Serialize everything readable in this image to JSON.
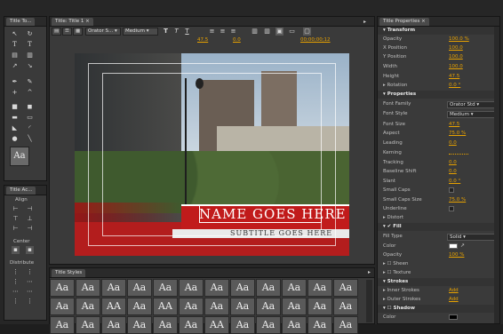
{
  "tabs": {
    "title_tools": "Title To...",
    "title_main": "Title: Title 1",
    "title_properties": "Title Properties",
    "title_actions": "Title Ac...",
    "title_styles": "Title Styles"
  },
  "toolbar": {
    "font_family": "Orator S...",
    "font_style": "Medium",
    "font_size": "47.5",
    "kerning": "0.0",
    "timecode": "00;00;00;12"
  },
  "title_text": {
    "name": "NAME GOES HERE",
    "subtitle": "SUBTITLE GOES HERE"
  },
  "actions": {
    "align": "Align",
    "center": "Center",
    "distribute": "Distribute"
  },
  "preview_glyph": "Aa",
  "properties": {
    "transform": "Transform",
    "opacity_label": "Opacity",
    "opacity": "100.0 %",
    "xpos_label": "X Position",
    "xpos": "100.0",
    "ypos_label": "Y Position",
    "ypos": "100.0",
    "width_label": "Width",
    "width": "100.0",
    "height_label": "Height",
    "height": "47.5",
    "rotation_label": "Rotation",
    "rotation": "0.0 °",
    "props": "Properties",
    "font_family_label": "Font Family",
    "font_family": "Orator Std",
    "font_style_label": "Font Style",
    "font_style": "Medium",
    "font_size_label": "Font Size",
    "font_size": "47.5",
    "aspect_label": "Aspect",
    "aspect": "75.0 %",
    "leading_label": "Leading",
    "leading": "0.0",
    "kerning_label": "Kerning",
    "kerning": "",
    "tracking_label": "Tracking",
    "tracking": "0.0",
    "baseline_label": "Baseline Shift",
    "baseline": "0.0",
    "slant_label": "Slant",
    "slant": "0.0 °",
    "smallcaps_label": "Small Caps",
    "smallcaps_size_label": "Small Caps Size",
    "smallcaps_size": "75.0 %",
    "underline_label": "Underline",
    "distort_label": "Distort",
    "fill": "Fill",
    "fill_type_label": "Fill Type",
    "fill_type": "Solid",
    "color_label": "Color",
    "fill_opacity_label": "Opacity",
    "fill_opacity": "100 %",
    "sheen_label": "Sheen",
    "texture_label": "Texture",
    "strokes": "Strokes",
    "inner_strokes_label": "Inner Strokes",
    "inner_strokes": "Add",
    "outer_strokes_label": "Outer Strokes",
    "outer_strokes": "Add",
    "shadow": "Shadow",
    "shadow_color_label": "Color"
  },
  "styles": [
    [
      "Aa",
      "Aa",
      "Aa",
      "Aa",
      "Aa",
      "Aa",
      "Aa",
      "Aa",
      "Aa",
      "Aa",
      "Aa",
      "Aa"
    ],
    [
      "Aa",
      "Aa",
      "AA",
      "Aa",
      "AA",
      "Aa",
      "Aa",
      "Aa",
      "Aa",
      "Aa",
      "Aa",
      "Aa"
    ],
    [
      "Aa",
      "Aa",
      "Aa",
      "Aa",
      "Aa",
      "Aa",
      "AA",
      "Aa",
      "Aa",
      "Aa",
      "Aa",
      "Aa"
    ]
  ],
  "colors": {
    "accent": "#e8a200",
    "red": "#b31d1d",
    "panel": "#3a3a3a"
  }
}
